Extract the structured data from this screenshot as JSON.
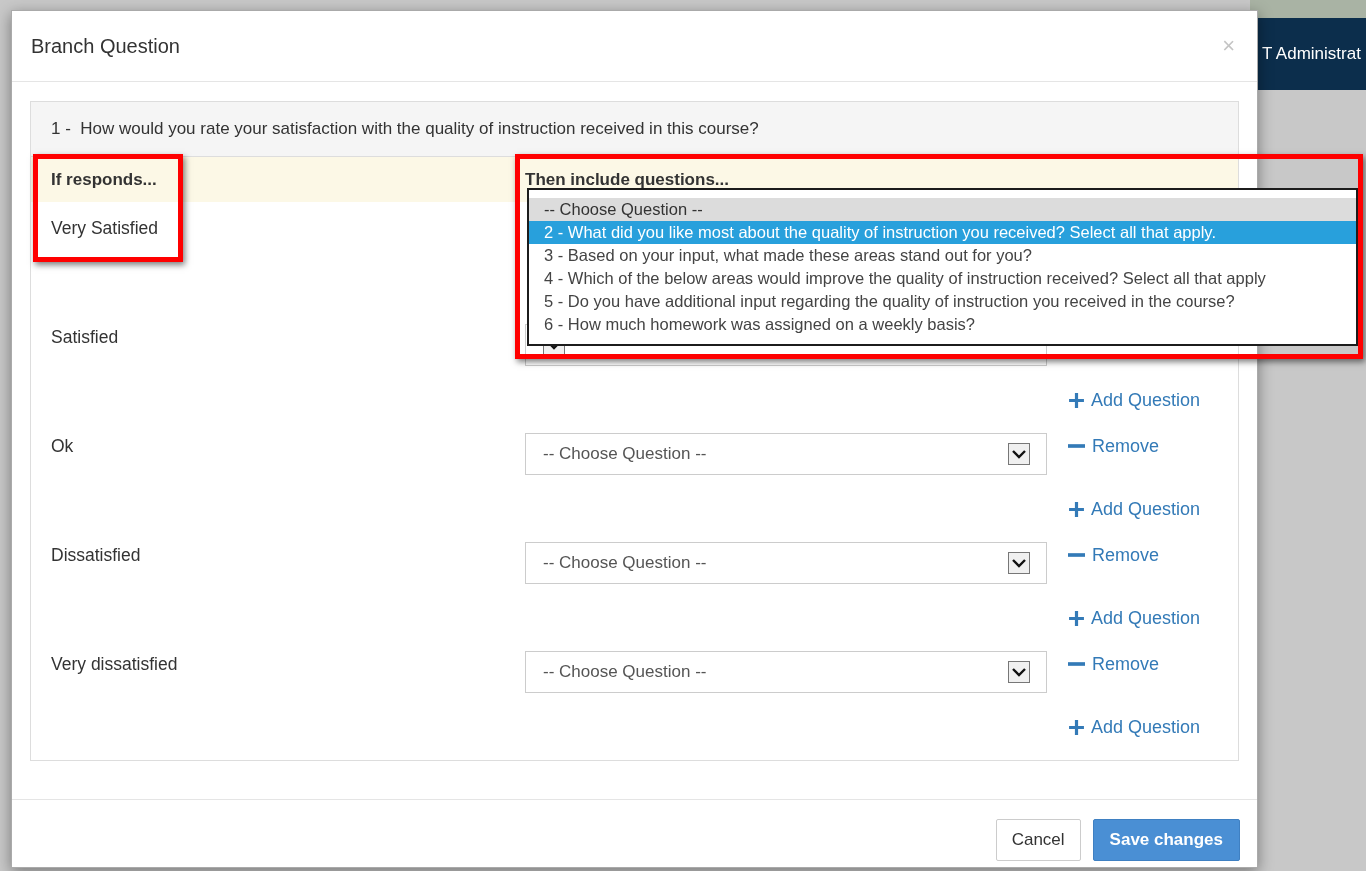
{
  "page_header": {
    "title": "T Administrat"
  },
  "dialog": {
    "title": "Branch Question",
    "close": "×",
    "question": "1 -  How would you rate your satisfaction with the quality of instruction received in this course?",
    "columns": [
      "If responds...",
      "Then include questions..."
    ],
    "responses": [
      {
        "label": "Very Satisfied"
      },
      {
        "label": "Satisfied",
        "select": {
          "partly_hidden": true
        },
        "add_question": "Add Question"
      },
      {
        "label": "Ok",
        "select": {
          "value": "-- Choose Question --"
        },
        "remove": "Remove",
        "add_question": "Add Question"
      },
      {
        "label": "Dissatisfied",
        "select": {
          "value": "-- Choose Question --"
        },
        "remove": "Remove",
        "add_question": "Add Question"
      },
      {
        "label": "Very dissatisfied",
        "select": {
          "value": "-- Choose Question --"
        },
        "remove": "Remove",
        "add_question": "Add Question"
      }
    ],
    "open_dropdown": {
      "options": [
        {
          "label": "-- Choose Question --",
          "current": true,
          "selected": false
        },
        {
          "label": "2 - What did you like most about the quality of instruction you received?  Select all that apply.",
          "current": false,
          "selected": true
        },
        {
          "label": "3 - Based on your input, what made these areas stand out for you?",
          "current": false,
          "selected": false
        },
        {
          "label": "4 - Which of the below areas would improve the quality of instruction received?  Select all that apply",
          "current": false,
          "selected": false
        },
        {
          "label": "5 - Do you have additional input regarding the quality of instruction you received in the course?",
          "current": false,
          "selected": false
        },
        {
          "label": "6 - How much homework was assigned on a weekly basis?",
          "current": false,
          "selected": false
        }
      ]
    },
    "buttons": [
      {
        "label": "Cancel",
        "kind": "default"
      },
      {
        "label": "Save changes",
        "kind": "primary"
      }
    ]
  }
}
